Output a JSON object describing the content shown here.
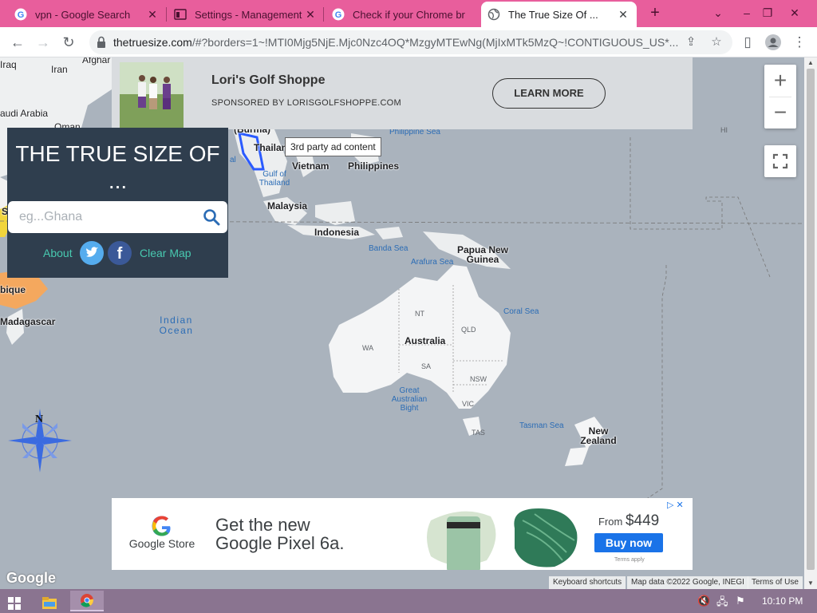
{
  "browser": {
    "tabs": [
      {
        "title": "vpn - Google Search",
        "icon": "google-icon",
        "active": false
      },
      {
        "title": "Settings - Management",
        "icon": "settings-page-icon",
        "active": false
      },
      {
        "title": "Check if your Chrome br",
        "icon": "google-icon",
        "active": false
      },
      {
        "title": "The True Size Of ...",
        "icon": "globe-icon",
        "active": true
      }
    ],
    "url_host": "thetruesize.com",
    "url_rest": "/#?borders=1~!MTI0Mjg5NjE.Mjc0Nzc4OQ*MzgyMTEwNg(MjIxMTk5MzQ~!CONTIGUOUS_US*..."
  },
  "top_ad": {
    "name": "Lori's Golf Shoppe",
    "sponsor": "SPONSORED BY LORISGOLFSHOPPE.COM",
    "cta": "LEARN MORE",
    "tooltip": "3rd party ad content"
  },
  "panel": {
    "title": "THE TRUE SIZE OF ...",
    "search_placeholder": "eg...Ghana",
    "about": "About",
    "clear": "Clear Map"
  },
  "map": {
    "labels": {
      "iraq": "Iraq",
      "iran": "Iran",
      "afghan": "Afghar",
      "saudi": "audi Arabia",
      "oman": "Oman",
      "thailand": "Thailan",
      "vietnam": "Vietnam",
      "philippines": "Philippines",
      "malaysia": "Malaysia",
      "indonesia": "Indonesia",
      "png": "Papua New Guinea",
      "australia": "Australia",
      "nz": "New Zealand",
      "madagascar": "Madagascar",
      "mozambique": "bique",
      "burma": "(Burma)",
      "s_cut": "S"
    },
    "seas": {
      "philippine_sea": "Philippine Sea",
      "gulf_thailand": "Gulf of Thailand",
      "banda_sea": "Banda Sea",
      "arafura_sea": "Arafura Sea",
      "coral_sea": "Coral Sea",
      "tasman_sea": "Tasman Sea",
      "great_bight": "Great Australian Bight",
      "indian_ocean": "Indian Ocean",
      "al_cut": "al"
    },
    "states": {
      "nt": "NT",
      "qld": "QLD",
      "wa": "WA",
      "sa": "SA",
      "nsw": "NSW",
      "vic": "VIC",
      "tas": "TAS",
      "hi": "HI"
    },
    "compass_n": "N",
    "google": "Google",
    "footer": {
      "shortcuts": "Keyboard shortcuts",
      "mapdata": "Map data ©2022 Google, INEGI",
      "terms": "Terms of Use"
    }
  },
  "bottom_ad": {
    "store": "Google Store",
    "headline": "Get the new Google Pixel 6a.",
    "from": "From",
    "price": "$449",
    "cta": "Buy now",
    "terms": "Terms apply"
  },
  "taskbar": {
    "clock": "10:10 PM"
  },
  "colors": {
    "tabstrip": "#e85e9c",
    "map_water": "#aab3bd",
    "panel_bg": "#2f3e4e",
    "accent_teal": "#48c9b0",
    "twitter": "#55acee",
    "facebook": "#3b5998",
    "buy_blue": "#1a73e8"
  }
}
